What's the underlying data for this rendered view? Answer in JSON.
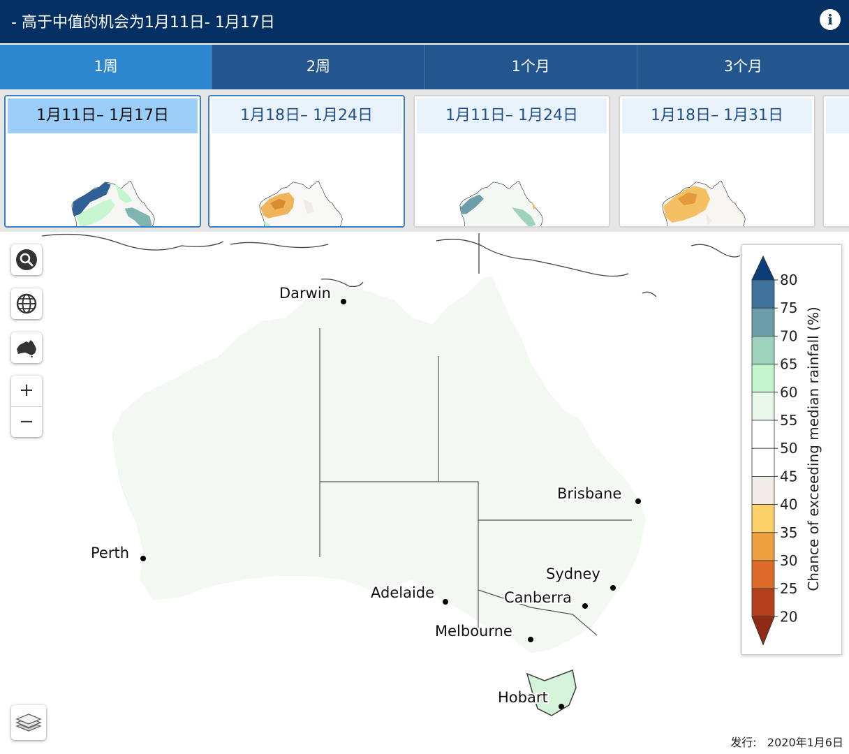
{
  "header": {
    "title": "- 高于中值的机会为1月11日- 1月17日",
    "info_icon": "info-icon"
  },
  "tabs": [
    {
      "label": "1周",
      "active": true
    },
    {
      "label": "2周",
      "active": false
    },
    {
      "label": "1个月",
      "active": false
    },
    {
      "label": "3个月",
      "active": false
    }
  ],
  "periods": [
    {
      "label": "1月11日– 1月17日"
    },
    {
      "label": "1月18日– 1月24日"
    },
    {
      "label": "1月11日– 1月24日"
    },
    {
      "label": "1月18日– 1月31日"
    }
  ],
  "map": {
    "controls": [
      "search-icon",
      "globe-icon",
      "australia-icon",
      "zoom-in",
      "zoom-out",
      "layers-icon"
    ],
    "zoom_in_label": "+",
    "zoom_out_label": "−",
    "cities": [
      {
        "name": "Darwin"
      },
      {
        "name": "Brisbane"
      },
      {
        "name": "Perth"
      },
      {
        "name": "Sydney"
      },
      {
        "name": "Adelaide"
      },
      {
        "name": "Canberra"
      },
      {
        "name": "Melbourne"
      },
      {
        "name": "Hobart"
      }
    ]
  },
  "legend": {
    "title": "Chance of exceeding median rainfall (%)",
    "ticks": [
      "80",
      "75",
      "70",
      "65",
      "60",
      "55",
      "50",
      "45",
      "40",
      "35",
      "30",
      "25",
      "20"
    ],
    "colors": [
      "#0c3d78",
      "#40739c",
      "#6b9eaa",
      "#9dd2bf",
      "#c3f5cd",
      "#e8f6ea",
      "#ffffff",
      "#ffffff",
      "#efebe6",
      "#fdd16a",
      "#eda040",
      "#dc6b2c",
      "#b4401b",
      "#8f2b14"
    ]
  },
  "issued": {
    "label": "发行:",
    "date": "2020年1月6日"
  }
}
